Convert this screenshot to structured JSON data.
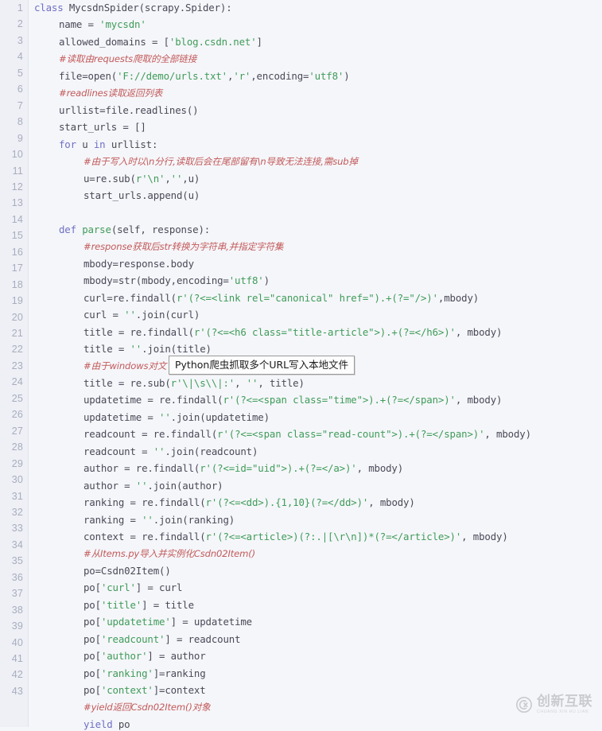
{
  "editor": {
    "language": "python",
    "background_color": "#f5f6fa",
    "gutter_color": "#eef0f6",
    "line_numbers": [
      1,
      2,
      3,
      4,
      5,
      6,
      7,
      8,
      9,
      10,
      11,
      12,
      13,
      14,
      15,
      16,
      17,
      18,
      19,
      20,
      21,
      22,
      23,
      24,
      25,
      26,
      27,
      28,
      29,
      30,
      31,
      32,
      33,
      34,
      35,
      36,
      37,
      38,
      39,
      40,
      41,
      42,
      43
    ],
    "colors": {
      "keyword": "#6f6fc4",
      "string": "#3f9c59",
      "comment": "#c25a5a",
      "plain": "#4a4a58",
      "line_number": "#a8adbd"
    },
    "lines": [
      {
        "indent": 0,
        "tokens": [
          {
            "t": "class ",
            "c": "kw"
          },
          {
            "t": "MycsdnSpider",
            "c": "pl"
          },
          {
            "t": "(scrapy.Spider):",
            "c": "pl"
          }
        ]
      },
      {
        "indent": 1,
        "tokens": [
          {
            "t": "name = ",
            "c": "pl"
          },
          {
            "t": "'mycsdn'",
            "c": "str"
          }
        ]
      },
      {
        "indent": 1,
        "tokens": [
          {
            "t": "allowed_domains = [",
            "c": "pl"
          },
          {
            "t": "'blog.csdn.net'",
            "c": "str"
          },
          {
            "t": "]",
            "c": "pl"
          }
        ]
      },
      {
        "indent": 1,
        "tokens": [
          {
            "t": "#读取由requests爬取的全部链接",
            "c": "cmt"
          }
        ]
      },
      {
        "indent": 1,
        "tokens": [
          {
            "t": "file=open(",
            "c": "pl"
          },
          {
            "t": "'F://demo/urls.txt'",
            "c": "str"
          },
          {
            "t": ",",
            "c": "pl"
          },
          {
            "t": "'r'",
            "c": "str"
          },
          {
            "t": ",encoding=",
            "c": "pl"
          },
          {
            "t": "'utf8'",
            "c": "str"
          },
          {
            "t": ")",
            "c": "pl"
          }
        ]
      },
      {
        "indent": 1,
        "tokens": [
          {
            "t": "#readlines读取返回列表",
            "c": "cmt"
          }
        ]
      },
      {
        "indent": 1,
        "tokens": [
          {
            "t": "urllist=file.readlines()",
            "c": "pl"
          }
        ]
      },
      {
        "indent": 1,
        "tokens": [
          {
            "t": "start_urls = []",
            "c": "pl"
          }
        ]
      },
      {
        "indent": 1,
        "tokens": [
          {
            "t": "for ",
            "c": "kw"
          },
          {
            "t": "u ",
            "c": "pl"
          },
          {
            "t": "in ",
            "c": "kw"
          },
          {
            "t": "urllist:",
            "c": "pl"
          }
        ]
      },
      {
        "indent": 2,
        "tokens": [
          {
            "t": "#由于写入时以\\n分行,读取后会在尾部留有\\n导致无法连接,需sub掉",
            "c": "cmt"
          }
        ]
      },
      {
        "indent": 2,
        "tokens": [
          {
            "t": "u=re.sub(",
            "c": "pl"
          },
          {
            "t": "r'\\n'",
            "c": "str"
          },
          {
            "t": ",",
            "c": "pl"
          },
          {
            "t": "''",
            "c": "str"
          },
          {
            "t": ",u)",
            "c": "pl"
          }
        ]
      },
      {
        "indent": 2,
        "tokens": [
          {
            "t": "start_urls.append(u)",
            "c": "pl"
          }
        ]
      },
      {
        "indent": 0,
        "tokens": []
      },
      {
        "indent": 1,
        "tokens": [
          {
            "t": "def ",
            "c": "kw"
          },
          {
            "t": "parse",
            "c": "fn"
          },
          {
            "t": "(self, response):",
            "c": "pl"
          }
        ]
      },
      {
        "indent": 2,
        "tokens": [
          {
            "t": "#response获取后str转换为字符串,并指定字符集",
            "c": "cmt"
          }
        ]
      },
      {
        "indent": 2,
        "tokens": [
          {
            "t": "mbody=response.body",
            "c": "pl"
          }
        ]
      },
      {
        "indent": 2,
        "tokens": [
          {
            "t": "mbody=str(mbody,encoding=",
            "c": "pl"
          },
          {
            "t": "'utf8'",
            "c": "str"
          },
          {
            "t": ")",
            "c": "pl"
          }
        ]
      },
      {
        "indent": 2,
        "tokens": [
          {
            "t": "curl=re.findall(",
            "c": "pl"
          },
          {
            "t": "r'(?<=<link rel=\"canonical\" href=\").+(?=\"/>)'",
            "c": "str"
          },
          {
            "t": ",mbody)",
            "c": "pl"
          }
        ]
      },
      {
        "indent": 2,
        "tokens": [
          {
            "t": "curl = ",
            "c": "pl"
          },
          {
            "t": "''",
            "c": "str"
          },
          {
            "t": ".join(curl)",
            "c": "pl"
          }
        ]
      },
      {
        "indent": 2,
        "tokens": [
          {
            "t": "title = re.findall(",
            "c": "pl"
          },
          {
            "t": "r'(?<=<h6 class=\"title-article\">).+(?=</h6>)'",
            "c": "str"
          },
          {
            "t": ", mbody)",
            "c": "pl"
          }
        ]
      },
      {
        "indent": 2,
        "tokens": [
          {
            "t": "title = ",
            "c": "pl"
          },
          {
            "t": "''",
            "c": "str"
          },
          {
            "t": ".join(title)",
            "c": "pl"
          }
        ]
      },
      {
        "indent": 2,
        "tokens": [
          {
            "t": "#由于windows对文",
            "c": "cmt"
          }
        ]
      },
      {
        "indent": 2,
        "tokens": [
          {
            "t": "title = re.sub(",
            "c": "pl"
          },
          {
            "t": "r'\\|\\s\\\\|:'",
            "c": "str"
          },
          {
            "t": ", ",
            "c": "pl"
          },
          {
            "t": "''",
            "c": "str"
          },
          {
            "t": ", title)",
            "c": "pl"
          }
        ]
      },
      {
        "indent": 2,
        "tokens": [
          {
            "t": "updatetime = re.findall(",
            "c": "pl"
          },
          {
            "t": "r'(?<=<span class=\"time\">).+(?=</span>)'",
            "c": "str"
          },
          {
            "t": ", mbody)",
            "c": "pl"
          }
        ]
      },
      {
        "indent": 2,
        "tokens": [
          {
            "t": "updatetime = ",
            "c": "pl"
          },
          {
            "t": "''",
            "c": "str"
          },
          {
            "t": ".join(updatetime)",
            "c": "pl"
          }
        ]
      },
      {
        "indent": 2,
        "tokens": [
          {
            "t": "readcount = re.findall(",
            "c": "pl"
          },
          {
            "t": "r'(?<=<span class=\"read-count\">).+(?=</span>)'",
            "c": "str"
          },
          {
            "t": ", mbody)",
            "c": "pl"
          }
        ]
      },
      {
        "indent": 2,
        "tokens": [
          {
            "t": "readcount = ",
            "c": "pl"
          },
          {
            "t": "''",
            "c": "str"
          },
          {
            "t": ".join(readcount)",
            "c": "pl"
          }
        ]
      },
      {
        "indent": 2,
        "tokens": [
          {
            "t": "author = re.findall(",
            "c": "pl"
          },
          {
            "t": "r'(?<=id=\"uid\">).+(?=</a>)'",
            "c": "str"
          },
          {
            "t": ", mbody)",
            "c": "pl"
          }
        ]
      },
      {
        "indent": 2,
        "tokens": [
          {
            "t": "author = ",
            "c": "pl"
          },
          {
            "t": "''",
            "c": "str"
          },
          {
            "t": ".join(author)",
            "c": "pl"
          }
        ]
      },
      {
        "indent": 2,
        "tokens": [
          {
            "t": "ranking = re.findall(",
            "c": "pl"
          },
          {
            "t": "r'(?<=<dd>).{1,10}(?=</dd>)'",
            "c": "str"
          },
          {
            "t": ", mbody)",
            "c": "pl"
          }
        ]
      },
      {
        "indent": 2,
        "tokens": [
          {
            "t": "ranking = ",
            "c": "pl"
          },
          {
            "t": "''",
            "c": "str"
          },
          {
            "t": ".join(ranking)",
            "c": "pl"
          }
        ]
      },
      {
        "indent": 2,
        "tokens": [
          {
            "t": "context = re.findall(",
            "c": "pl"
          },
          {
            "t": "r'(?<=<article>)(?:.|[\\r\\n])*(?=</article>)'",
            "c": "str"
          },
          {
            "t": ", mbody)",
            "c": "pl"
          }
        ]
      },
      {
        "indent": 2,
        "tokens": [
          {
            "t": "#从Items.py导入并实例化Csdn02Item()",
            "c": "cmt"
          }
        ]
      },
      {
        "indent": 2,
        "tokens": [
          {
            "t": "po=Csdn02Item()",
            "c": "pl"
          }
        ]
      },
      {
        "indent": 2,
        "tokens": [
          {
            "t": "po[",
            "c": "pl"
          },
          {
            "t": "'curl'",
            "c": "str"
          },
          {
            "t": "] = curl",
            "c": "pl"
          }
        ]
      },
      {
        "indent": 2,
        "tokens": [
          {
            "t": "po[",
            "c": "pl"
          },
          {
            "t": "'title'",
            "c": "str"
          },
          {
            "t": "] = title",
            "c": "pl"
          }
        ]
      },
      {
        "indent": 2,
        "tokens": [
          {
            "t": "po[",
            "c": "pl"
          },
          {
            "t": "'updatetime'",
            "c": "str"
          },
          {
            "t": "] = updatetime",
            "c": "pl"
          }
        ]
      },
      {
        "indent": 2,
        "tokens": [
          {
            "t": "po[",
            "c": "pl"
          },
          {
            "t": "'readcount'",
            "c": "str"
          },
          {
            "t": "] = readcount",
            "c": "pl"
          }
        ]
      },
      {
        "indent": 2,
        "tokens": [
          {
            "t": "po[",
            "c": "pl"
          },
          {
            "t": "'author'",
            "c": "str"
          },
          {
            "t": "] = author",
            "c": "pl"
          }
        ]
      },
      {
        "indent": 2,
        "tokens": [
          {
            "t": "po[",
            "c": "pl"
          },
          {
            "t": "'ranking'",
            "c": "str"
          },
          {
            "t": "]=ranking",
            "c": "pl"
          }
        ]
      },
      {
        "indent": 2,
        "tokens": [
          {
            "t": "po[",
            "c": "pl"
          },
          {
            "t": "'context'",
            "c": "str"
          },
          {
            "t": "]=context",
            "c": "pl"
          }
        ]
      },
      {
        "indent": 2,
        "tokens": [
          {
            "t": "#yield返回Csdn02Item()对象",
            "c": "cmt"
          }
        ]
      },
      {
        "indent": 2,
        "tokens": [
          {
            "t": "yield ",
            "c": "kw"
          },
          {
            "t": "po",
            "c": "pl"
          }
        ]
      }
    ]
  },
  "tooltip": {
    "text": "Python爬虫抓取多个URL写入本地文件"
  },
  "watermark": {
    "cn": "创新互联",
    "en": "CHUANG XIN HU LIAN",
    "logo": "cx-logo-icon"
  }
}
